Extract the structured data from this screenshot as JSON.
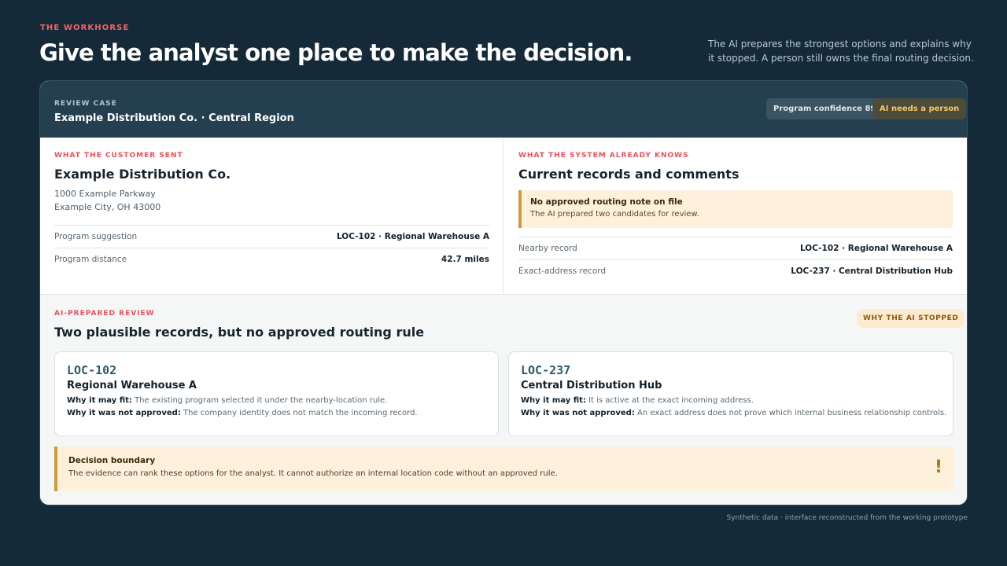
{
  "header": {
    "eyebrow": "THE WORKHORSE",
    "title": "Give the analyst one place to make the decision.",
    "intro": "The AI prepares the strongest options and explains why it stopped. A person still owns the final routing decision."
  },
  "case": {
    "label": "REVIEW CASE",
    "title": "Example Distribution Co. · Central Region",
    "confidence_badge": "Program confidence 89",
    "status_badge": "AI needs a person"
  },
  "customer": {
    "label": "WHAT THE CUSTOMER SENT",
    "name": "Example Distribution Co.",
    "address_line1": "1000 Example Parkway",
    "address_line2": "Example City, OH 43000",
    "rows": [
      {
        "key": "Program suggestion",
        "value": "LOC-102 · Regional Warehouse A"
      },
      {
        "key": "Program distance",
        "value": "42.7 miles"
      }
    ]
  },
  "system": {
    "label": "WHAT THE SYSTEM ALREADY KNOWS",
    "title": "Current records and comments",
    "alert_title": "No approved routing note on file",
    "alert_text": "The AI prepared two candidates for review.",
    "rows": [
      {
        "key": "Nearby record",
        "value": "LOC-102 · Regional Warehouse A"
      },
      {
        "key": "Exact-address record",
        "value": "LOC-237 · Central Distribution Hub"
      }
    ]
  },
  "review": {
    "label": "AI-PREPARED REVIEW",
    "title": "Two plausible records, but no approved routing rule",
    "why_badge": "WHY THE AI STOPPED",
    "fit_label": "Why it may fit:",
    "not_label": "Why it was not approved:",
    "candidates": [
      {
        "code": "LOC-102",
        "name": "Regional Warehouse A",
        "fit": "The existing program selected it under the nearby-location rule.",
        "not": "The company identity does not match the incoming record."
      },
      {
        "code": "LOC-237",
        "name": "Central Distribution Hub",
        "fit": "It is active at the exact incoming address.",
        "not": "An exact address does not prove which internal business relationship controls."
      }
    ],
    "boundary_title": "Decision boundary",
    "boundary_text": "The evidence can rank these options for the analyst. It cannot authorize an internal location code without an approved rule.",
    "boundary_icon": "!"
  },
  "footer": "Synthetic data · interface reconstructed from the working prototype"
}
